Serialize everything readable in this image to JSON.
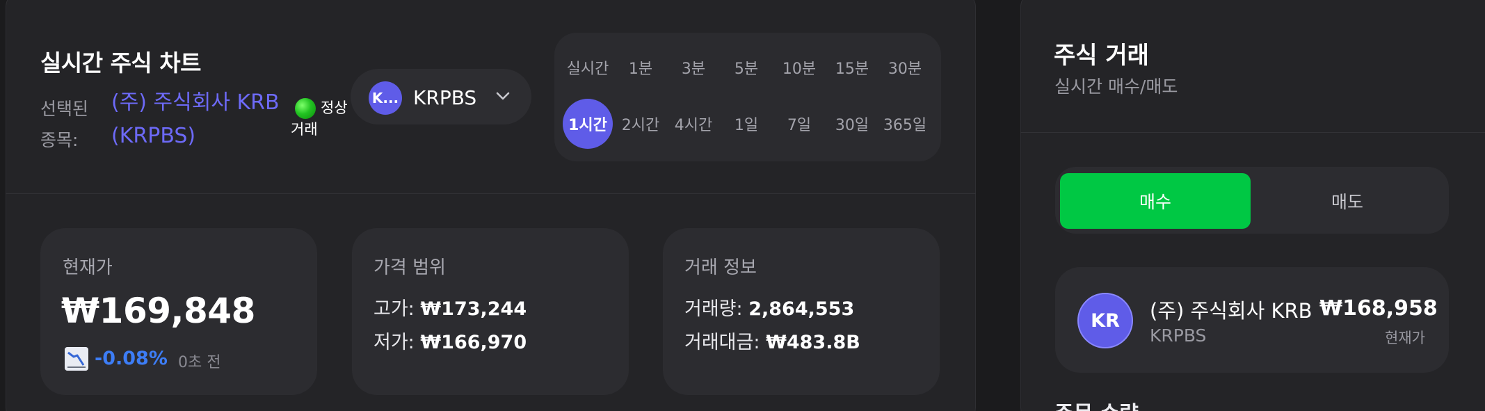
{
  "chart_panel": {
    "title": "실시간 주식 차트",
    "selected_label": "선택된 종목:",
    "selected_value": "(주) 주식회사 KRB (KRPBS)",
    "status": "정상 거래",
    "status_color": "#22c322",
    "ticker_select": {
      "avatar": "K...",
      "label": "KRPBS",
      "icon": "chevron-down-icon"
    },
    "timeframes_row1": [
      "실시간",
      "1분",
      "3분",
      "5분",
      "10분",
      "15분",
      "30분"
    ],
    "timeframes_row2": [
      "1시간",
      "2시간",
      "4시간",
      "1일",
      "7일",
      "30일",
      "365일"
    ],
    "active_timeframe": "1시간"
  },
  "cards": {
    "current": {
      "title": "현재가",
      "price": "₩169,848",
      "change": "-0.08%",
      "ago": "0초 전",
      "icon": "chart-decreasing-icon"
    },
    "range": {
      "title": "가격 범위",
      "high_label": "고가:",
      "high_value": "₩173,244",
      "low_label": "저가:",
      "low_value": "₩166,970"
    },
    "trade": {
      "title": "거래 정보",
      "volume_label": "거래량:",
      "volume_value": "2,864,553",
      "amount_label": "거래대금:",
      "amount_value": "₩483.8B"
    }
  },
  "trade_panel": {
    "title": "주식 거래",
    "subtitle": "실시간 매수/매도",
    "buy_label": "매수",
    "sell_label": "매도",
    "buy_color": "#00c844",
    "stock": {
      "avatar": "KR",
      "name": "(주) 주식회사 KRB",
      "code": "KRPBS",
      "price": "₩168,958",
      "price_label": "현재가"
    },
    "qty_label": "주문 수량"
  }
}
